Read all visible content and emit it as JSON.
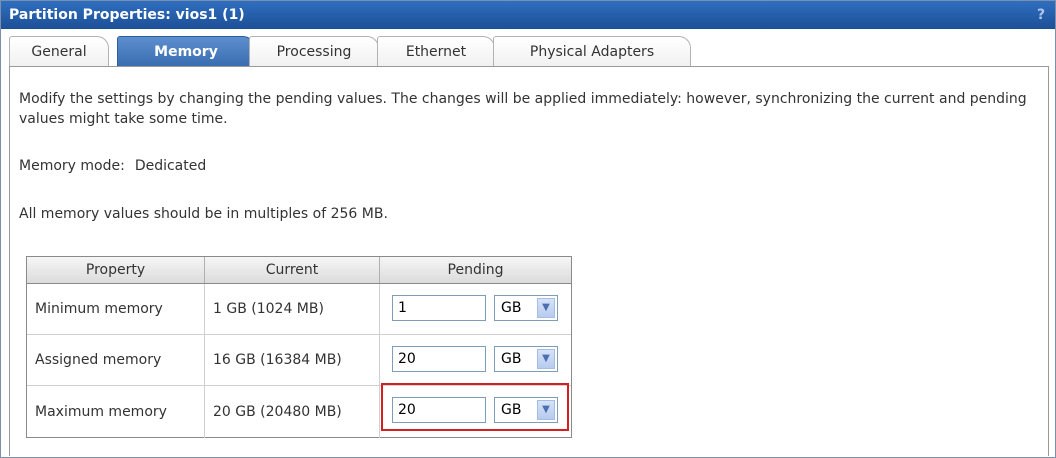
{
  "window": {
    "title": "Partition Properties: vios1 (1)",
    "help_glyph": "?"
  },
  "tabs": [
    {
      "label": "General",
      "active": false
    },
    {
      "label": "Memory",
      "active": true
    },
    {
      "label": "Processing",
      "active": false
    },
    {
      "label": "Ethernet",
      "active": false
    },
    {
      "label": "Physical Adapters",
      "active": false
    }
  ],
  "content": {
    "description": "Modify the settings by changing the pending values. The changes will be applied immediately: however, synchronizing the current and pending values might take some time.",
    "memory_mode_label": "Memory mode:",
    "memory_mode_value": "Dedicated",
    "multiples_note": "All memory values should be in multiples of 256 MB."
  },
  "table": {
    "headers": [
      "Property",
      "Current",
      "Pending"
    ],
    "rows": [
      {
        "property": "Minimum memory",
        "current": "1 GB (1024 MB)",
        "pending_value": "1",
        "pending_unit": "GB"
      },
      {
        "property": "Assigned memory",
        "current": "16 GB (16384 MB)",
        "pending_value": "20",
        "pending_unit": "GB"
      },
      {
        "property": "Maximum memory",
        "current": "20 GB (20480 MB)",
        "pending_value": "20",
        "pending_unit": "GB"
      }
    ]
  },
  "icons": {
    "select_arrow": "chevron-down-icon",
    "help": "help-icon"
  },
  "colors": {
    "titlebar": "#1d4f96",
    "active_tab": "#3a6db0",
    "highlight_box": "#d42020"
  }
}
